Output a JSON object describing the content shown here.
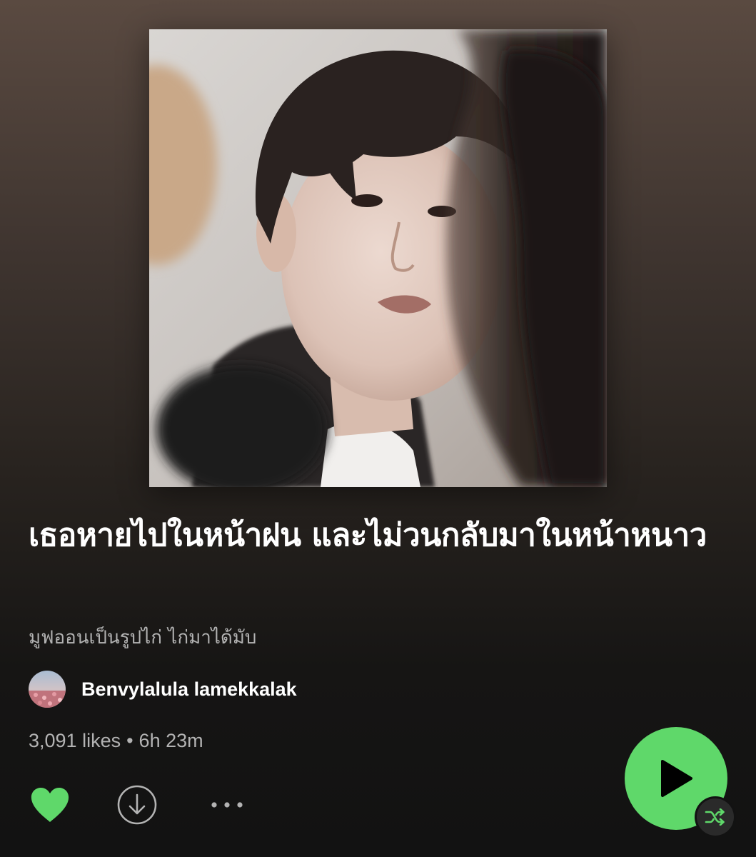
{
  "playlist": {
    "cover_image": "playlist-cover-photo",
    "title": "เธอหายไปในหน้าฝน และไม่วนกลับมาในหน้าหนาว",
    "description": "มูฟออนเป็นรูปไก่ ไก่มาได้มับ",
    "owner": {
      "name": "Benvylalula lamekkalak",
      "avatar": "owner-avatar"
    },
    "likes": "3,091 likes",
    "separator": "•",
    "duration": "6h 23m"
  },
  "actions": {
    "heart_icon": "heart-icon",
    "download_icon": "download-icon",
    "more_icon": "more-options-icon",
    "play_icon": "play-icon",
    "shuffle_icon": "shuffle-icon"
  },
  "colors": {
    "accent": "#1ed760",
    "text_primary": "#ffffff",
    "text_secondary": "#b3b3b3",
    "background_top": "#5a4a41",
    "background_bottom": "#121212"
  }
}
